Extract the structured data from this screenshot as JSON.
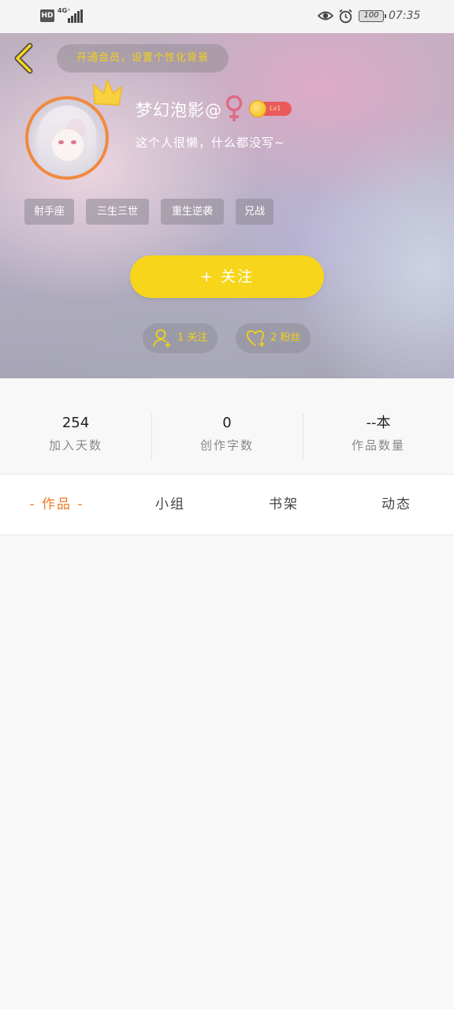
{
  "status_bar": {
    "hd": "HD",
    "network": "4G⁺",
    "battery": "100",
    "time": "07:35"
  },
  "header": {
    "vip_promo": "开通会员，设置个性化背景",
    "username": "梦幻泡影@",
    "level": "Lv1",
    "bio": "这个人很懒，什么都没写~",
    "tags": [
      "射手座",
      "三生三世",
      "重生逆袭",
      "兄战"
    ],
    "follow_button": "+  关注",
    "following": "1 关注",
    "fans": "2 粉丝"
  },
  "stats": [
    {
      "value": "254",
      "label": "加入天数"
    },
    {
      "value": "0",
      "label": "创作字数"
    },
    {
      "value": "--本",
      "label": "作品数量"
    }
  ],
  "tabs": [
    {
      "label": "- 作品 -",
      "active": true
    },
    {
      "label": "小组",
      "active": false
    },
    {
      "label": "书架",
      "active": false
    },
    {
      "label": "动态",
      "active": false
    }
  ],
  "colors": {
    "accent_yellow": "#f6d51a",
    "tab_active": "#f07a28",
    "avatar_border": "#f08a3e",
    "female_symbol": "#e26a86",
    "level_badge": "#ea5a5a"
  }
}
